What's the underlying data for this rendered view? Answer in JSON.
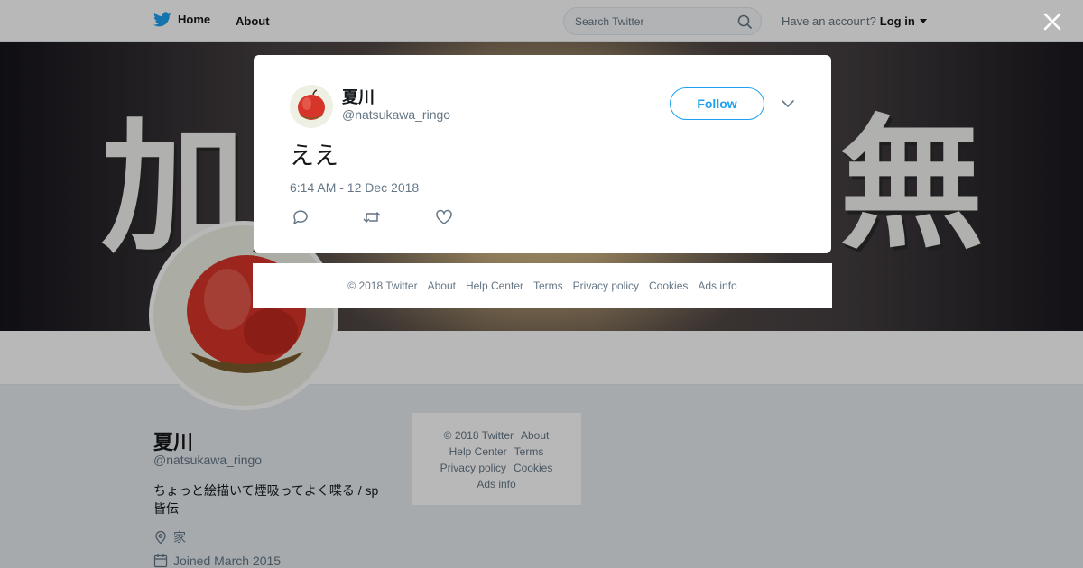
{
  "topbar": {
    "home_label": "Home",
    "about_label": "About",
    "search_placeholder": "Search Twitter",
    "account_prompt": "Have an account?",
    "login_label": "Log in"
  },
  "banner": {
    "text_left": "加",
    "text_right": "無"
  },
  "profile": {
    "name": "夏川",
    "handle": "@natsukawa_ringo",
    "bio": "ちょっと絵描いて煙吸ってよく喋る / sp皆伝",
    "location": "家",
    "joined": "Joined March 2015"
  },
  "side_footer": {
    "links": [
      "© 2018 Twitter",
      "About",
      "Help Center",
      "Terms",
      "Privacy policy",
      "Cookies",
      "Ads info"
    ]
  },
  "tweet": {
    "name": "夏川",
    "handle": "@natsukawa_ringo",
    "follow_label": "Follow",
    "text": "ええ",
    "timestamp": "6:14 AM - 12 Dec 2018"
  },
  "modal_footer": {
    "links": [
      "© 2018 Twitter",
      "About",
      "Help Center",
      "Terms",
      "Privacy policy",
      "Cookies",
      "Ads info"
    ]
  },
  "colors": {
    "accent": "#1da1f2",
    "secondary_text": "#657786",
    "background": "#e6ecf0"
  },
  "icons": {
    "logo": "twitter-bird-icon",
    "search": "search-icon",
    "close": "close-icon",
    "location": "location-pin-icon",
    "calendar": "calendar-icon",
    "reply": "reply-icon",
    "retweet": "retweet-icon",
    "like": "heart-icon",
    "more": "chevron-down-icon"
  }
}
